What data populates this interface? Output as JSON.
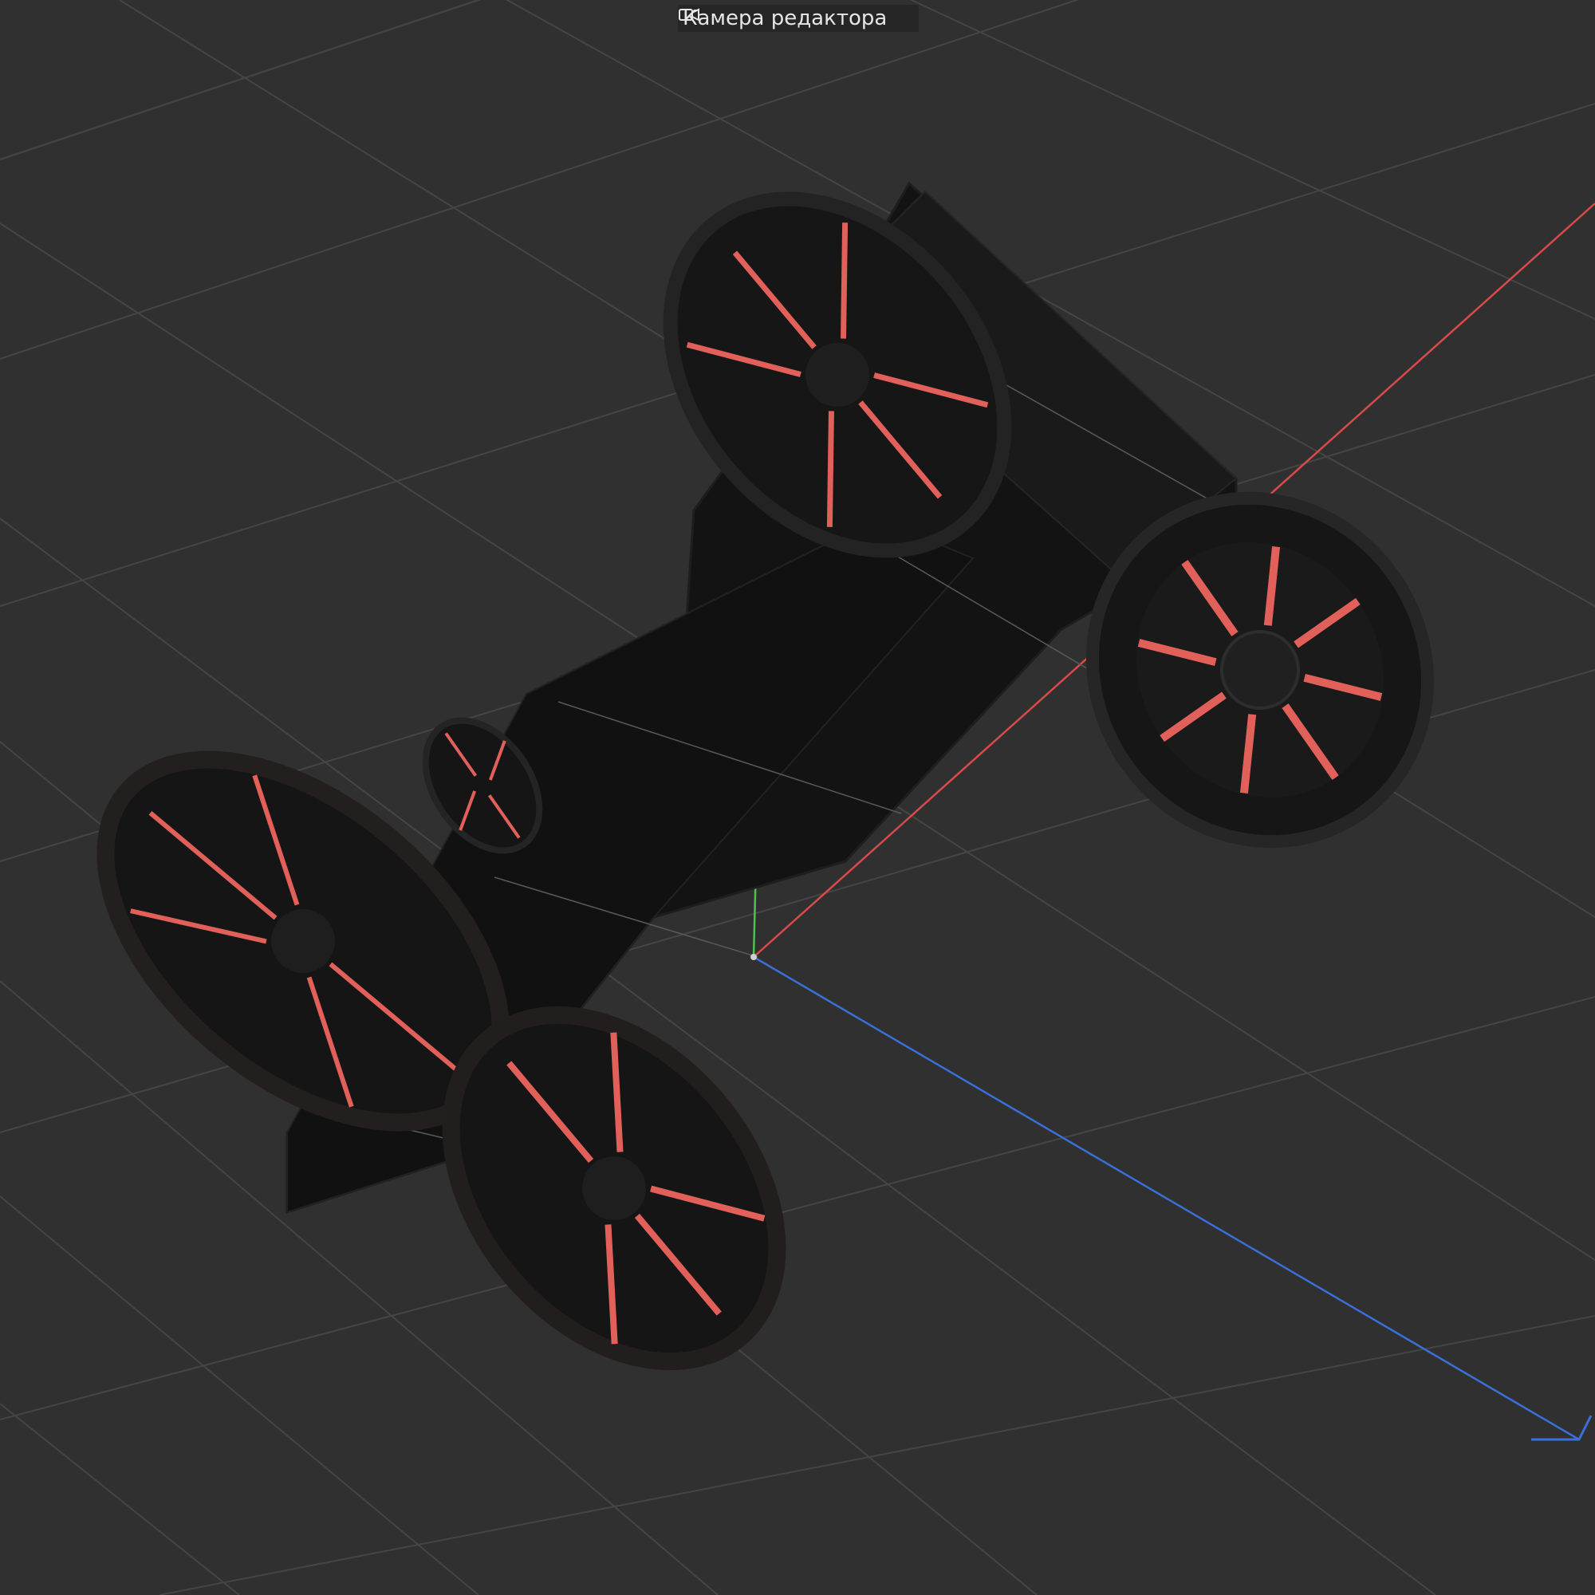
{
  "viewport": {
    "camera_label": "Камера редактора",
    "camera_icon": "camera-icon",
    "background_color": "#303030",
    "grid_color": "#4a4a4a",
    "axis_x_color": "#d94a4a",
    "axis_y_color": "#4ec24e",
    "axis_z_color": "#3a6fd8",
    "model_body_color": "#141414",
    "model_accent_color": "#e2605a"
  }
}
